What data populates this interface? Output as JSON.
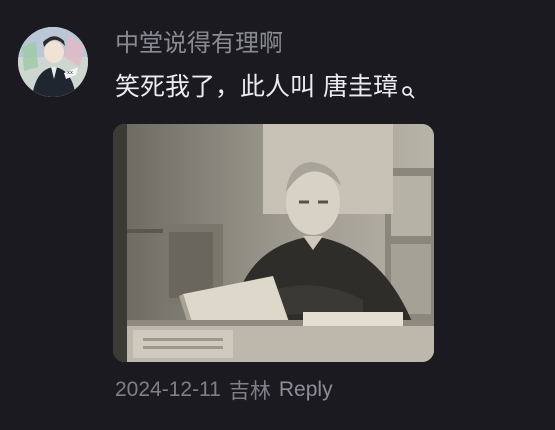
{
  "comment": {
    "username": "中堂说得有理啊",
    "text": "笑死我了，此人叫",
    "linked_name": "唐圭璋",
    "link_icon": "search-icon",
    "photo_icon": "photo",
    "date": "2024-12-11",
    "location": "吉林",
    "reply_label": "Reply"
  },
  "colors": {
    "background": "#1a1a20",
    "username": "#8a8a92",
    "text": "#ececf0",
    "meta": "#7f7f88"
  }
}
